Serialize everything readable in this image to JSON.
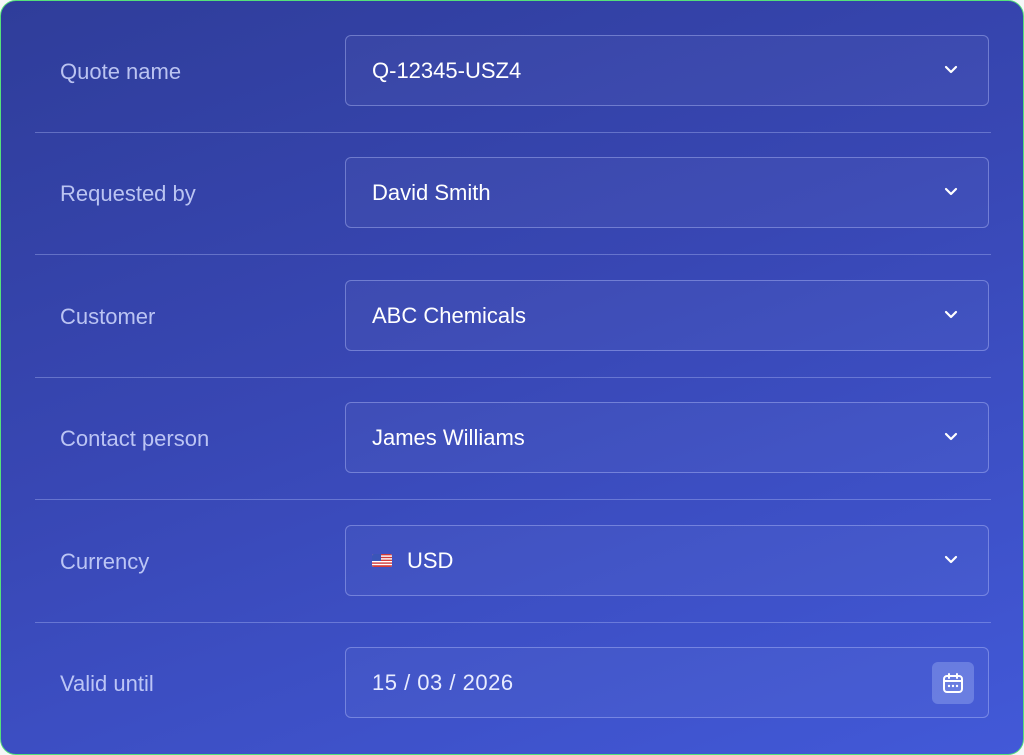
{
  "form": {
    "rows": [
      {
        "label": "Quote name",
        "value": "Q-12345-USZ4",
        "icon": "chevron-down-icon"
      },
      {
        "label": "Requested by",
        "value": "David Smith",
        "icon": "chevron-down-icon"
      },
      {
        "label": "Customer",
        "value": "ABC Chemicals",
        "icon": "chevron-down-icon"
      },
      {
        "label": "Contact person",
        "value": "James Williams",
        "icon": "chevron-down-icon"
      },
      {
        "label": "Currency",
        "value": "USD",
        "flag_icon": "us-flag-icon",
        "icon": "chevron-down-icon"
      },
      {
        "label": "Valid until",
        "value": "15 / 03 / 2026",
        "icon": "calendar-icon"
      }
    ]
  },
  "colors": {
    "background_start": "#2f3d9a",
    "background_end": "#4259d8",
    "label_text": "#d2daff",
    "value_text": "#ffffff",
    "card_border": "#55e07a"
  }
}
